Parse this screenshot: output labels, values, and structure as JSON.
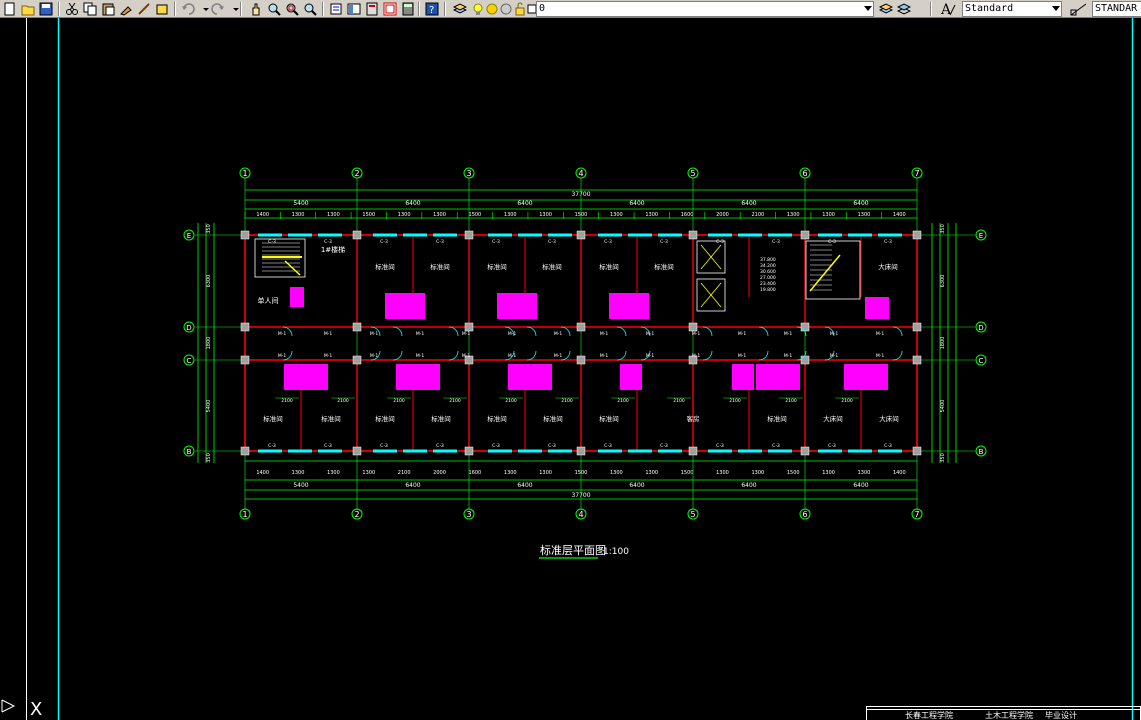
{
  "toolbar": {
    "layer_value": "0",
    "text_style_value": "Standard",
    "dim_style_value": "STANDAR",
    "icons": [
      "cut-icon",
      "copy-icon",
      "paste-icon",
      "match-properties-icon",
      "undo-icon",
      "redo-icon",
      "pan-icon",
      "zoom-realtime-icon",
      "zoom-window-icon",
      "zoom-previous-icon",
      "properties-icon",
      "design-center-icon",
      "tool-palettes-icon",
      "calculator-icon",
      "help-icon",
      "layer-manager-icon",
      "layer-state-icons",
      "text-style-icon",
      "dim-style-icon"
    ]
  },
  "drawing": {
    "axis_numbers": [
      "1",
      "2",
      "3",
      "4",
      "5",
      "6",
      "7"
    ],
    "axis_letters": [
      "E",
      "D",
      "C",
      "B"
    ],
    "overall_dim": "37700",
    "bay_dims": [
      "5400",
      "6400",
      "6400",
      "6400",
      "6400",
      "6400"
    ],
    "top_sub_dims": [
      "1400",
      "1300",
      "1300",
      "1500",
      "1300",
      "1300",
      "1500",
      "1300",
      "1300",
      "1500",
      "1300",
      "1300",
      "1600",
      "2000",
      "2100",
      "1300",
      "1300",
      "1300",
      "1400"
    ],
    "side_dims_left": [
      "350",
      "6300",
      "1800",
      "5400",
      "350"
    ],
    "side_dims_right": [
      "350",
      "6300",
      "1800",
      "5400",
      "350"
    ],
    "window_labels": [
      "C-3",
      "C-3",
      "C-3",
      "C-3",
      "C-3",
      "C-3",
      "C-3",
      "C-3",
      "C-3",
      "C-3",
      "C-3",
      "C-3"
    ],
    "door_labels": [
      "M-1",
      "M-1",
      "M-1",
      "M-1",
      "M-1",
      "M-1",
      "M-1",
      "M-1",
      "M-1",
      "M-1",
      "M-1",
      "M-1",
      "M-1",
      "M-1"
    ],
    "room_names_top": [
      "标准间",
      "标准间",
      "标准间",
      "标准间",
      "标准间",
      "标准间",
      "大床间"
    ],
    "room_names_bottom": [
      "标准间",
      "标准间",
      "标准间",
      "标准间",
      "标准间",
      "标准间",
      "标准间",
      "客房",
      "标准间",
      "大床间",
      "大床间"
    ],
    "single_room": "单人间",
    "stair_label": "1#楼梯",
    "elevations": [
      "37.800",
      "34.200",
      "30.600",
      "27.000",
      "23.400",
      "19.800"
    ],
    "sub_room_dims": [
      "2100",
      "2100",
      "2100",
      "2100",
      "2100",
      "2100",
      "2100",
      "2100",
      "2100",
      "2100",
      "2100"
    ],
    "title": "标准层平面图",
    "scale": "1:100"
  },
  "titleblock": {
    "school": "长春工程学院",
    "dept": "土木工程学院",
    "project": "毕业设计"
  },
  "colors": {
    "background": "#000000",
    "axis_cyan": "#00ffff",
    "wall_red": "#ff0000",
    "dim_green": "#00ff00",
    "text_white": "#ffffff",
    "sanitary_magenta": "#ff00ff",
    "window_cyan": "#00ffff",
    "stair_yellow": "#ffff00"
  }
}
